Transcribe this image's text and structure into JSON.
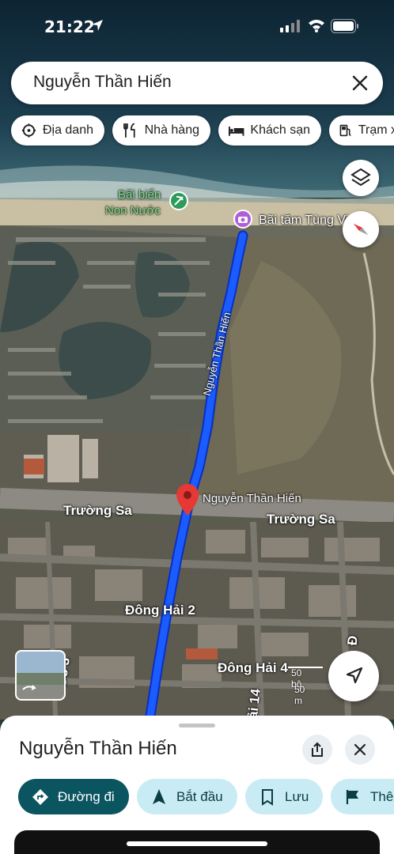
{
  "status_bar": {
    "time": "21:22"
  },
  "search": {
    "value": "Nguyễn Thần Hiến"
  },
  "chips": [
    {
      "label": "Địa danh",
      "icon": "landmark-icon"
    },
    {
      "label": "Nhà hàng",
      "icon": "restaurant-icon"
    },
    {
      "label": "Khách sạn",
      "icon": "hotel-icon"
    },
    {
      "label": "Trạm x",
      "icon": "gas-station-icon"
    }
  ],
  "map": {
    "poi_beach": {
      "line1": "Bãi biển",
      "line2": "Non Nước"
    },
    "poi_bathing": "Bãi tắm Tùng Vi",
    "route_label": "Nguyễn Thần Hiến",
    "pin_label": "Nguyễn Thần Hiến",
    "road_truong_sa_left": "Trường Sa",
    "road_truong_sa_right": "Trường Sa",
    "road_dong_hai_2": "Đông Hải 2",
    "road_dong_hai_4": "Đông Hải 4",
    "road_side_left": "Đỗ 3",
    "road_side_mid": "ải 14",
    "road_side_right": "Đ"
  },
  "scale": {
    "top": "50 bộ",
    "bottom": "50 m"
  },
  "sheet": {
    "title": "Nguyễn Thần Hiến",
    "actions": {
      "directions": "Đường đi",
      "start": "Bắt đầu",
      "save": "Lưu",
      "more": "Thê"
    }
  },
  "colors": {
    "route": "#1a5cff",
    "pin": "#e53935",
    "primary_button": "#0b5560",
    "secondary_button": "#c9ecf4"
  }
}
